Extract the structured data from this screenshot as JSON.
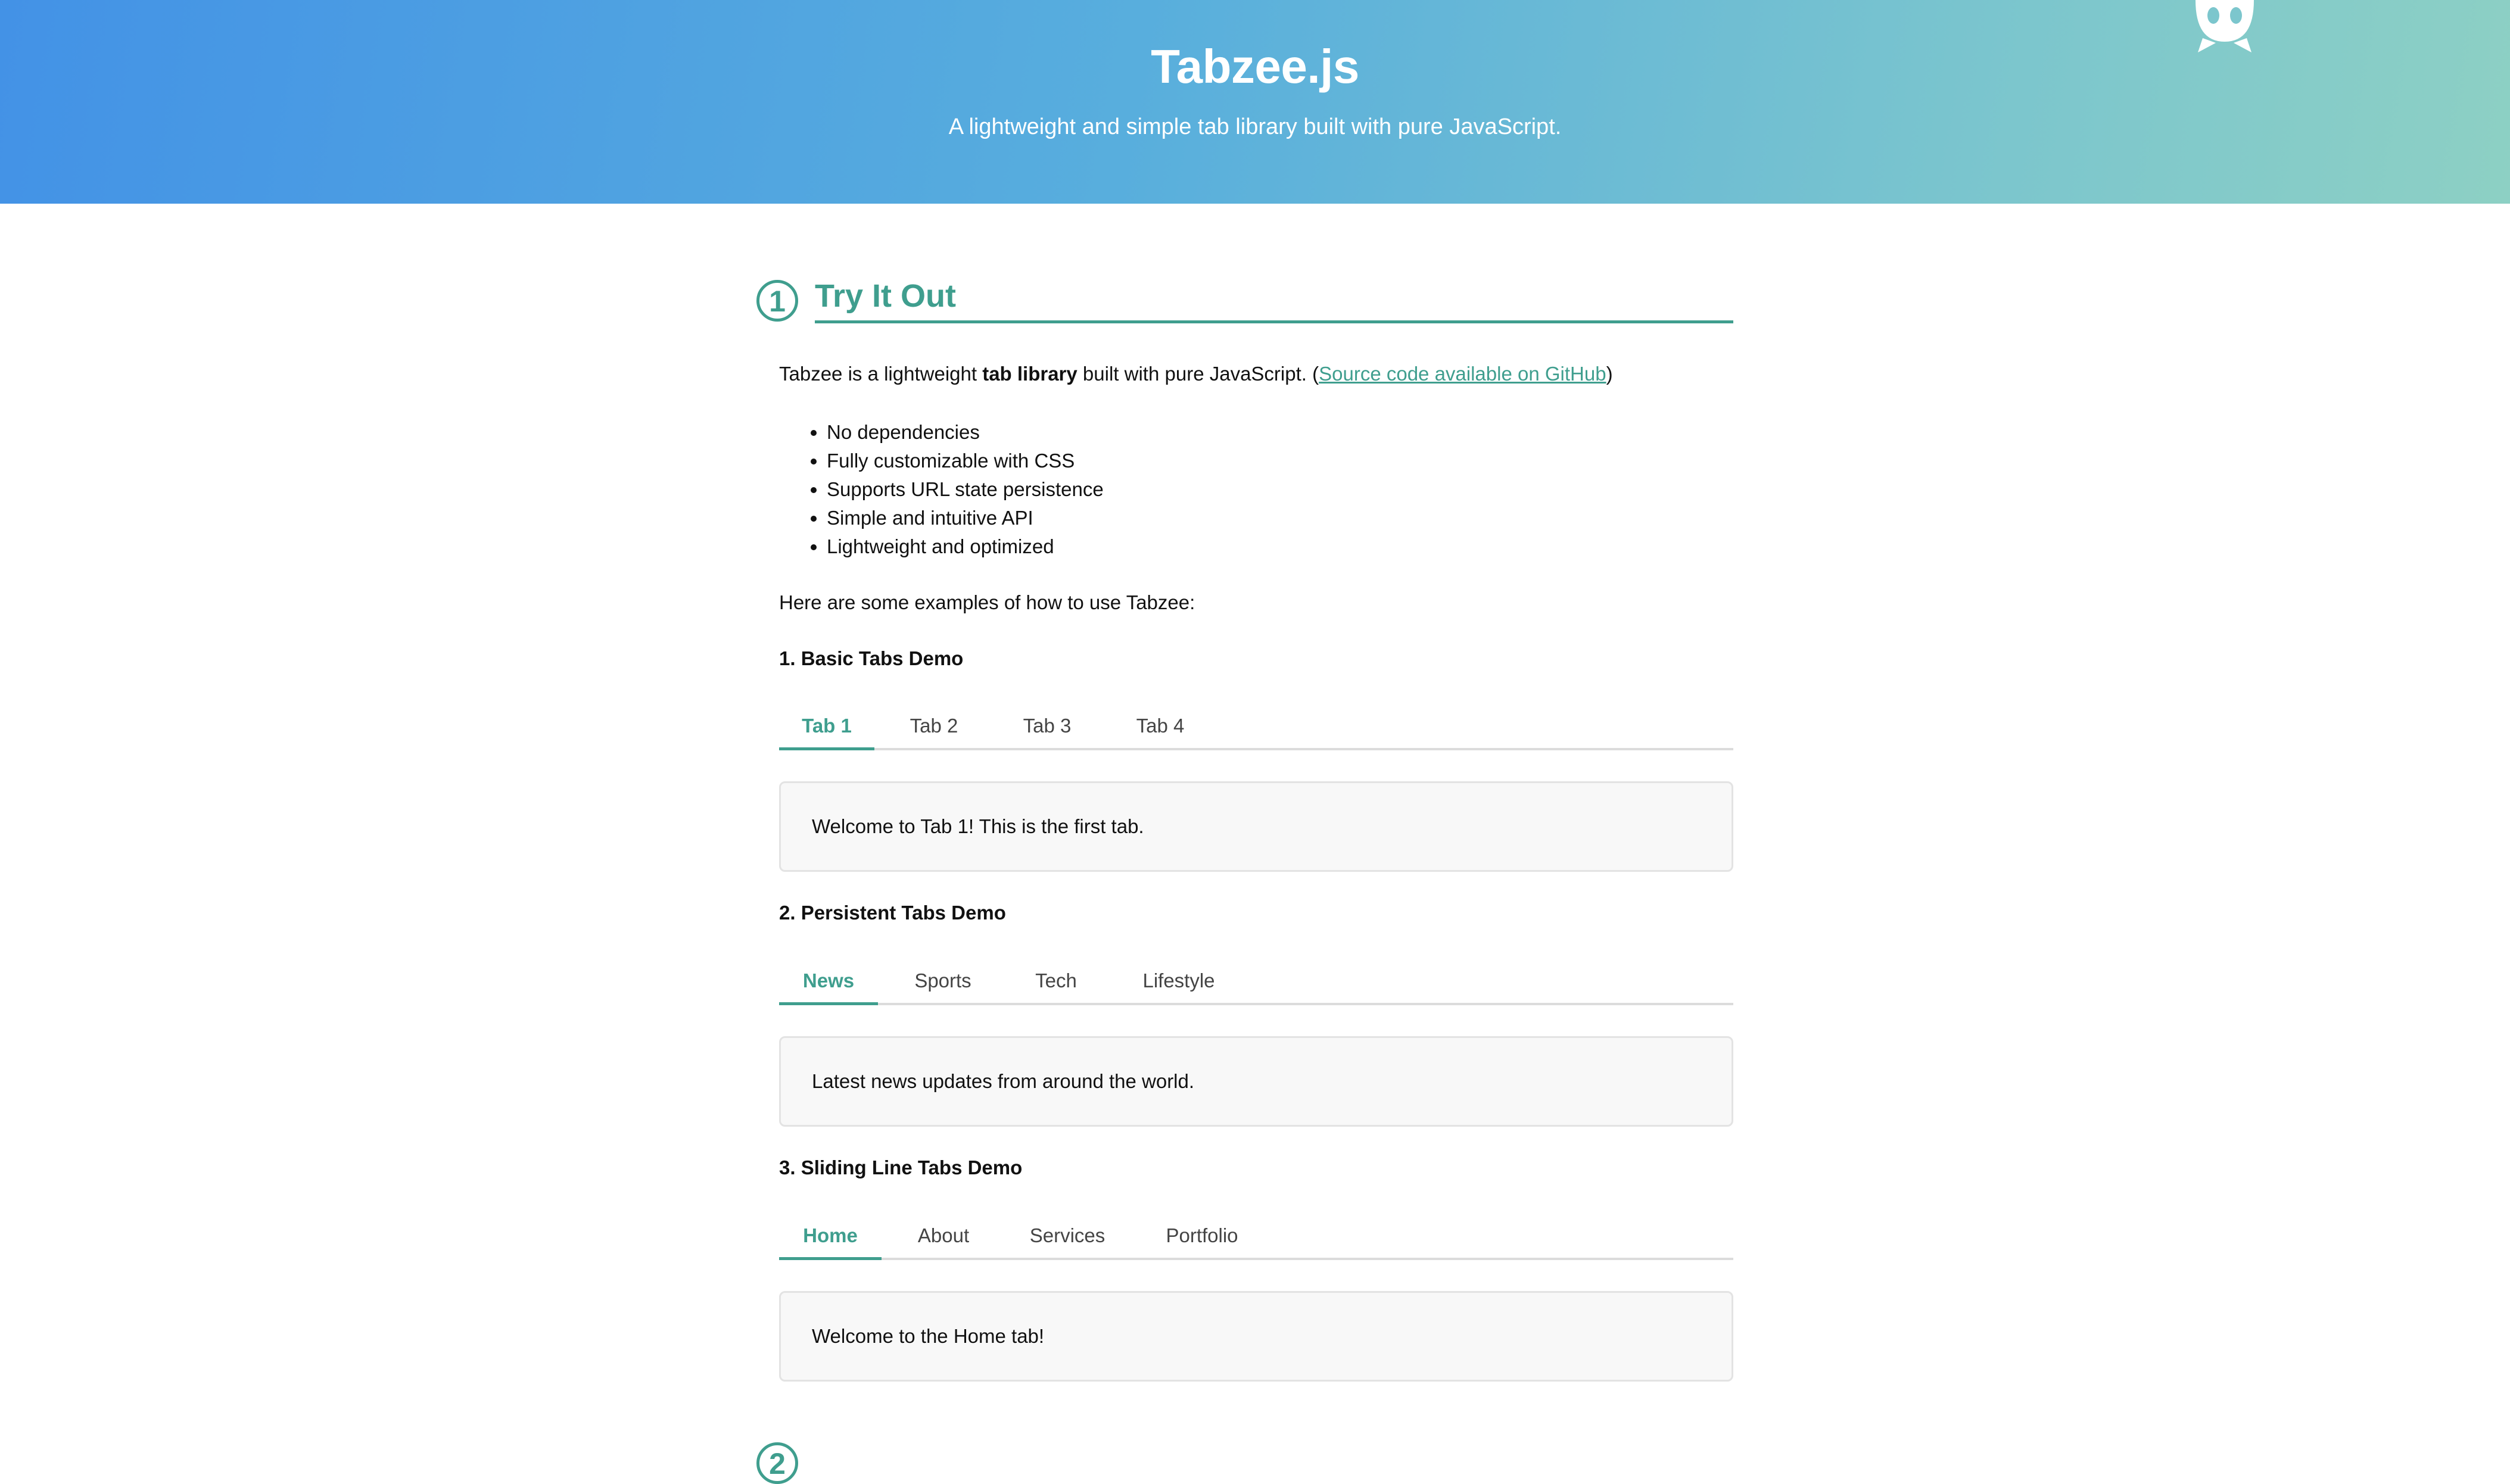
{
  "header": {
    "title": "Tabzee.js",
    "subtitle": "A lightweight and simple tab library built with pure JavaScript.",
    "github_icon": "github-octocat-icon"
  },
  "section1": {
    "number": "1",
    "title": "Try It Out",
    "intro_prefix": "Tabzee is a lightweight ",
    "intro_bold": "tab library",
    "intro_middle": " built with pure JavaScript. (",
    "intro_link": "Source code available on GitHub",
    "intro_suffix": ")",
    "features": [
      "No dependencies",
      "Fully customizable with CSS",
      "Supports URL state persistence",
      "Simple and intuitive API",
      "Lightweight and optimized"
    ],
    "examples_intro": "Here are some examples of how to use Tabzee:"
  },
  "demos": [
    {
      "title": "1. Basic Tabs Demo",
      "tabs": [
        "Tab 1",
        "Tab 2",
        "Tab 3",
        "Tab 4"
      ],
      "active": "Tab 1",
      "content": "Welcome to Tab 1! This is the first tab."
    },
    {
      "title": "2. Persistent Tabs Demo",
      "tabs": [
        "News",
        "Sports",
        "Tech",
        "Lifestyle"
      ],
      "active": "News",
      "content": "Latest news updates from around the world."
    },
    {
      "title": "3. Sliding Line Tabs Demo",
      "tabs": [
        "Home",
        "About",
        "Services",
        "Portfolio"
      ],
      "active": "Home",
      "content": "Welcome to the Home tab!"
    }
  ],
  "section2": {
    "number": "2"
  },
  "colors": {
    "accent": "#3f9e8e",
    "header_gradient_start": "#4392e6",
    "header_gradient_end": "#8dd0c4"
  }
}
